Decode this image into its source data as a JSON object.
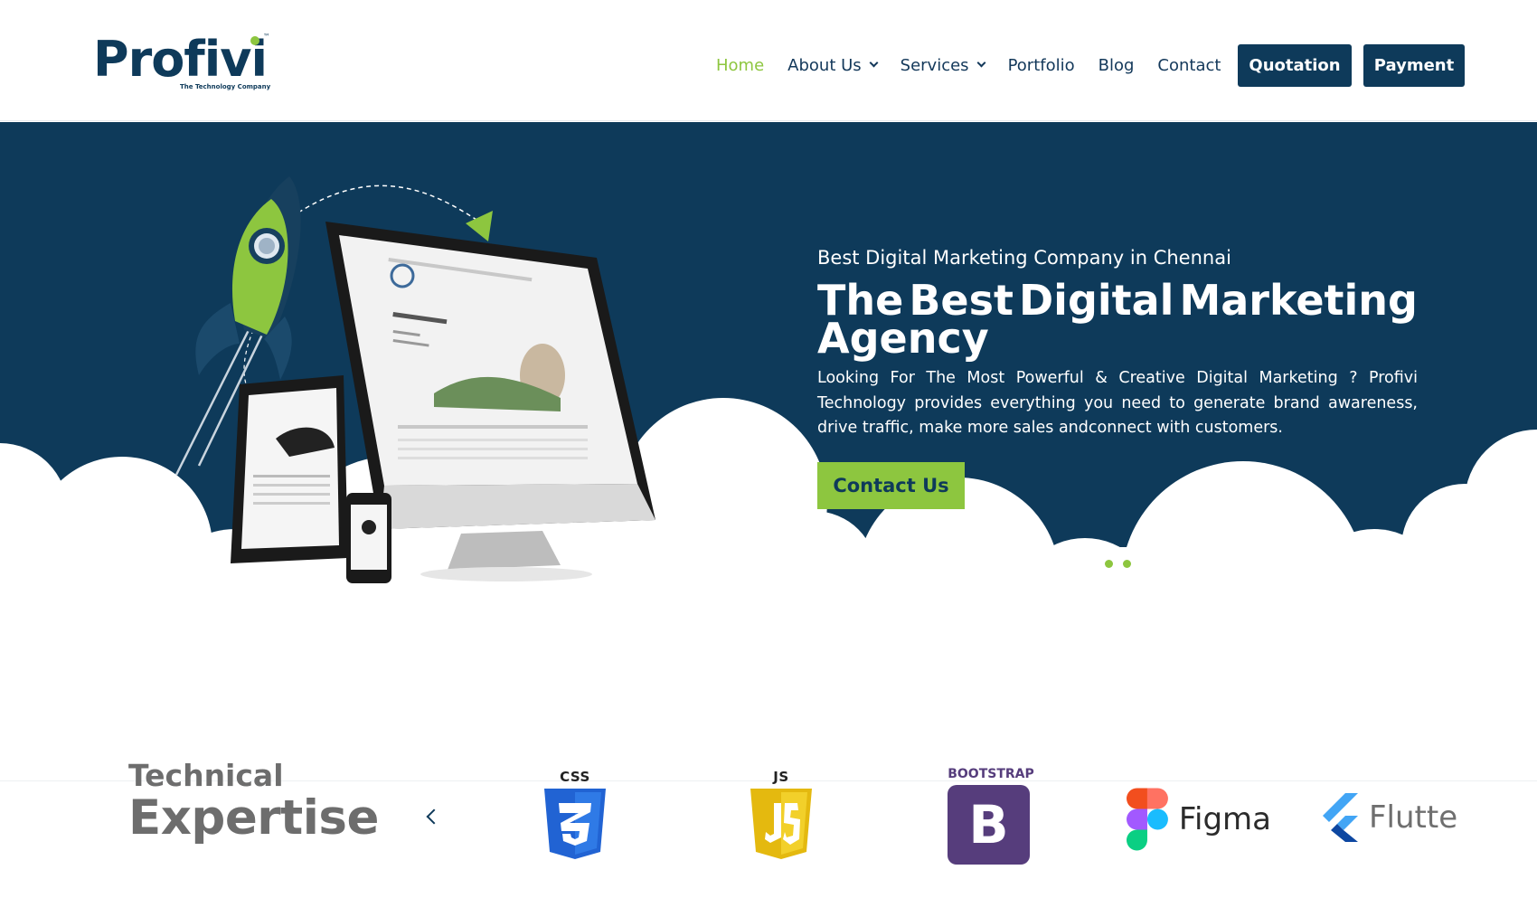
{
  "brand": {
    "name": "Profivi",
    "tagline": "The Technology Company",
    "trademark": "™",
    "primary_color": "#0e3a5a",
    "accent_color": "#8dc63f"
  },
  "nav": {
    "items": [
      {
        "label": "Home",
        "active": true,
        "has_dropdown": false
      },
      {
        "label": "About Us",
        "active": false,
        "has_dropdown": true
      },
      {
        "label": "Services",
        "active": false,
        "has_dropdown": true
      },
      {
        "label": "Portfolio",
        "active": false,
        "has_dropdown": false
      },
      {
        "label": "Blog",
        "active": false,
        "has_dropdown": false
      },
      {
        "label": "Contact",
        "active": false,
        "has_dropdown": false
      }
    ],
    "quotation_label": "Quotation",
    "payment_label": "Payment"
  },
  "hero": {
    "subtitle": "Best Digital Marketing Company in Chennai",
    "title_line1_words": [
      "The",
      "Best",
      "Digital",
      "Marketing"
    ],
    "title_line2": "Agency",
    "description": "Looking For The Most Powerful & Creative Digital Marketing ? Profivi Technology provides everything you need to generate brand awareness, drive traffic, make more sales andconnect with customers.",
    "cta_label": "Contact Us",
    "slide_count": 2,
    "background_color": "#0e3a5a"
  },
  "tech": {
    "title_small": "Technical",
    "title_large": "Expertise",
    "logos": [
      {
        "name": "CSS",
        "label": "CSS",
        "icon": "css3-icon"
      },
      {
        "name": "JavaScript",
        "label": "JS",
        "icon": "js-icon"
      },
      {
        "name": "Bootstrap",
        "label": "BOOTSTRAP",
        "icon": "bootstrap-icon",
        "glyph": "B"
      },
      {
        "name": "Figma",
        "label": "Figma",
        "icon": "figma-icon"
      },
      {
        "name": "Flutter",
        "label": "Flutte",
        "icon": "flutter-icon"
      }
    ]
  }
}
